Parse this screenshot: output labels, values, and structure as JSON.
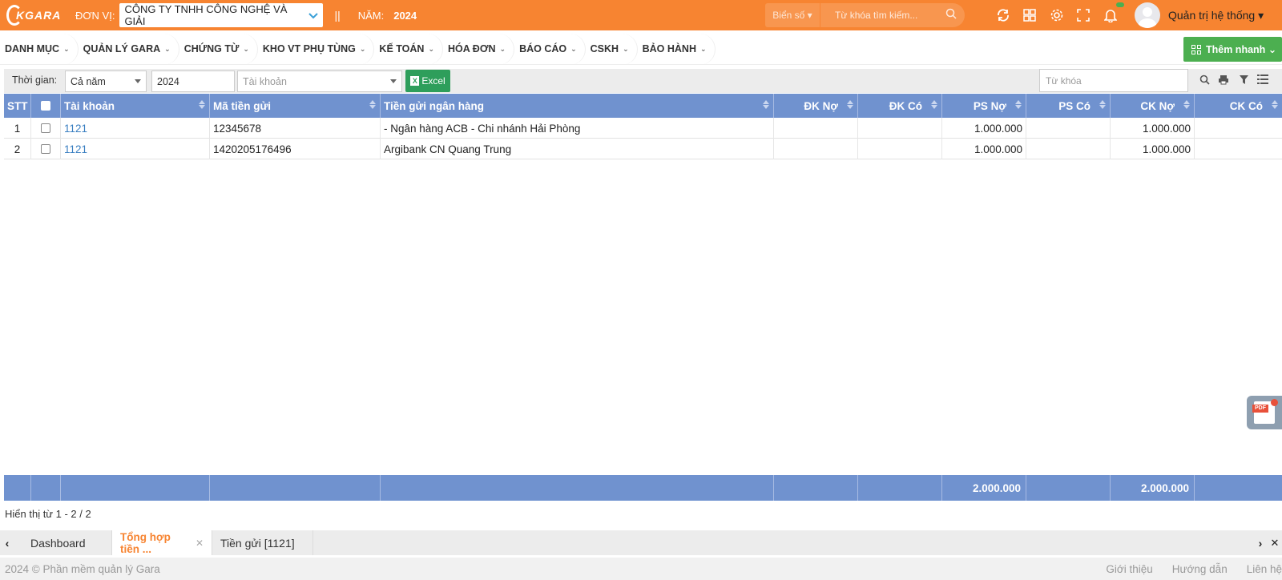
{
  "topbar": {
    "logo_text": "KGARA",
    "unit_label": "ĐƠN VỊ:",
    "unit_value": "CÔNG TY TNHH CÔNG NGHỆ VÀ GIẢI",
    "separator": "||",
    "year_label": "NĂM:",
    "year_value": "2024",
    "plate_label": "Biển số",
    "search_placeholder": "Từ khóa tìm kiếm...",
    "user_name": "Quản trị hệ thống",
    "brand_color": "#f78431"
  },
  "nav": {
    "items": [
      {
        "label": "DANH MỤC"
      },
      {
        "label": "QUẢN LÝ GARA"
      },
      {
        "label": "CHỨNG TỪ"
      },
      {
        "label": "KHO VT PHỤ TÙNG"
      },
      {
        "label": "KẾ TOÁN"
      },
      {
        "label": "HÓA ĐƠN"
      },
      {
        "label": "BÁO CÁO"
      },
      {
        "label": "CSKH"
      },
      {
        "label": "BẢO HÀNH"
      }
    ],
    "quick_add": "Thêm nhanh"
  },
  "filter": {
    "time_label": "Thời gian:",
    "period": "Cả năm",
    "year": "2024",
    "account_placeholder": "Tài khoản",
    "excel_label": "Excel",
    "keyword_placeholder": "Từ khóa"
  },
  "table": {
    "headers": [
      "STT",
      "",
      "Tài khoản",
      "Mã tiền gửi",
      "Tiền gửi ngân hàng",
      "ĐK Nợ",
      "ĐK Có",
      "PS Nợ",
      "PS Có",
      "CK Nợ",
      "CK Có"
    ],
    "rows": [
      {
        "stt": "1",
        "account": "1121",
        "code": "12345678",
        "bank": "- Ngân hàng ACB - Chi nhánh Hải Phòng",
        "dk_no": "",
        "dk_co": "",
        "ps_no": "1.000.000",
        "ps_co": "",
        "ck_no": "1.000.000",
        "ck_co": ""
      },
      {
        "stt": "2",
        "account": "1121",
        "code": "1420205176496",
        "bank": "Argibank CN Quang Trung",
        "dk_no": "",
        "dk_co": "",
        "ps_no": "1.000.000",
        "ps_co": "",
        "ck_no": "1.000.000",
        "ck_co": ""
      }
    ],
    "footer": {
      "ps_no": "2.000.000",
      "ck_no": "2.000.000"
    },
    "header_color": "#7092cf"
  },
  "paging": {
    "text": "Hiển thị từ 1 - 2 / 2"
  },
  "tabs": [
    {
      "label": "Dashboard",
      "active": false
    },
    {
      "label": "Tổng hợp tiền ...",
      "active": true
    },
    {
      "label": "Tiền gửi [1121]",
      "active": false
    }
  ],
  "pdf": {
    "tag": "PDF"
  },
  "footer": {
    "copyright": "2024 © Phần mềm quản lý Gara",
    "links": [
      "Giới thiệu",
      "Hướng dẫn",
      "Liên hệ"
    ]
  }
}
